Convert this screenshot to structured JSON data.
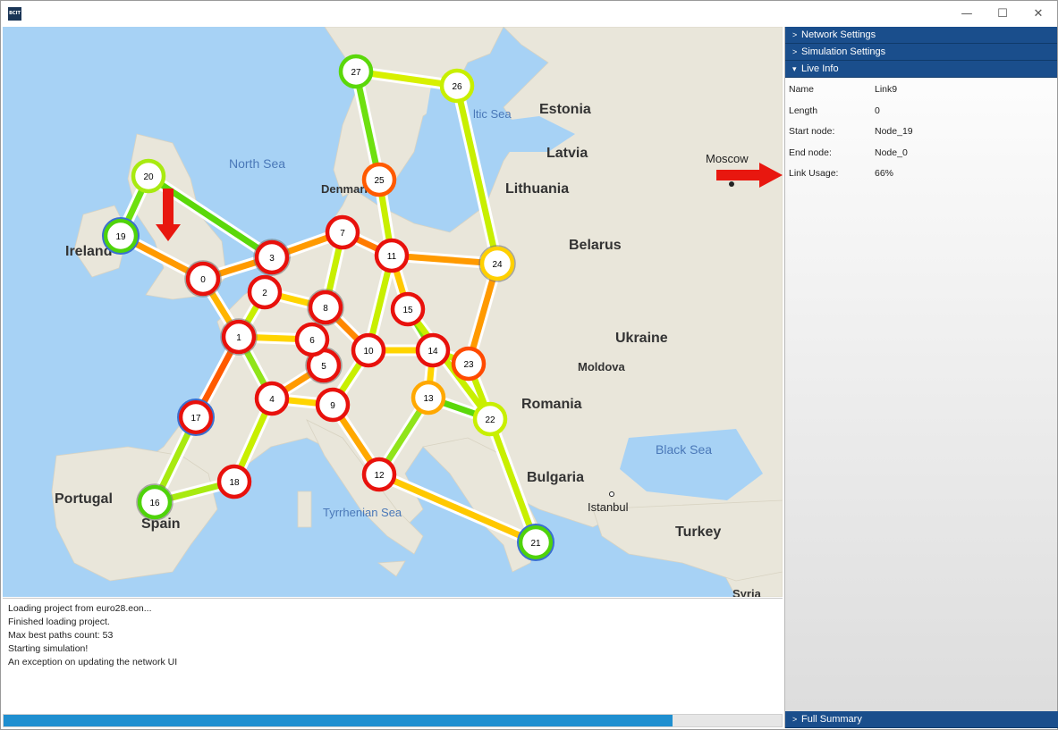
{
  "window": {
    "icon_text": "BCIT",
    "minimize_glyph": "—",
    "maximize_glyph": "☐",
    "close_glyph": "✕"
  },
  "map": {
    "labels": [
      {
        "id": "north-sea",
        "text": "North Sea"
      },
      {
        "id": "denmark",
        "text": "Denmark"
      },
      {
        "id": "ireland",
        "text": "Ireland"
      },
      {
        "id": "estonia",
        "text": "Estonia"
      },
      {
        "id": "latvia",
        "text": "Latvia"
      },
      {
        "id": "lithuania",
        "text": "Lithuania"
      },
      {
        "id": "belarus",
        "text": "Belarus"
      },
      {
        "id": "moscow",
        "text": "Moscow"
      },
      {
        "id": "ukraine",
        "text": "Ukraine"
      },
      {
        "id": "moldova",
        "text": "Moldova"
      },
      {
        "id": "romania",
        "text": "Romania"
      },
      {
        "id": "black-sea",
        "text": "Black Sea"
      },
      {
        "id": "bulgaria",
        "text": "Bulgaria"
      },
      {
        "id": "istanbul",
        "text": "Istanbul"
      },
      {
        "id": "turkey",
        "text": "Turkey"
      },
      {
        "id": "portugal",
        "text": "Portugal"
      },
      {
        "id": "spain",
        "text": "Spain"
      },
      {
        "id": "tyrrhenian",
        "text": "Tyrrhenian Sea"
      },
      {
        "id": "baltic",
        "text": "ltic Sea"
      },
      {
        "id": "syria",
        "text": "Syria"
      }
    ],
    "nodes": [
      "0",
      "1",
      "2",
      "3",
      "4",
      "5",
      "6",
      "7",
      "8",
      "9",
      "10",
      "11",
      "12",
      "13",
      "14",
      "15",
      "16",
      "17",
      "18",
      "19",
      "20",
      "21",
      "22",
      "23",
      "24",
      "25",
      "26",
      "27"
    ]
  },
  "log": {
    "lines": [
      "Loading project from euro28.eon...",
      "Finished loading project.",
      "Max best paths count: 53",
      "Starting simulation!",
      "An exception on updating the network UI"
    ],
    "progress": 0.86
  },
  "panel": {
    "network_settings": "Network Settings",
    "simulation_settings": "Simulation Settings",
    "live_info": "Live Info",
    "full_summary": "Full Summary",
    "collapsed_chevron": ">",
    "expanded_chevron": "▾",
    "info": [
      {
        "key": "Name",
        "value": "Link9"
      },
      {
        "key": "Length",
        "value": "0"
      },
      {
        "key": "Start node:",
        "value": "Node_19"
      },
      {
        "key": "End node:",
        "value": "Node_0"
      },
      {
        "key": "Link Usage:",
        "value": "66%"
      }
    ]
  },
  "colors": {
    "header_blue": "#1a4e8c",
    "progress_blue": "#1f8fd0",
    "sea": "#a7d2f5",
    "land": "#e8e4d8",
    "arrow_red": "#e8170f"
  }
}
